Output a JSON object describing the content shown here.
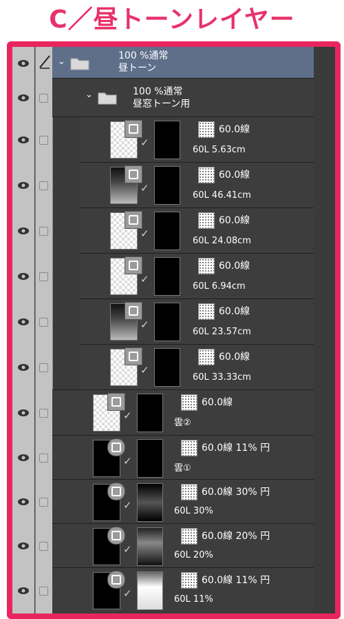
{
  "title": "C／昼トーンレイヤー",
  "folders": [
    {
      "line1": "100 %通常",
      "line2": "昼トーン"
    },
    {
      "line1": "100 %通常",
      "line2": "昼窓トーン用"
    }
  ],
  "layers": [
    {
      "tone": "60.0線",
      "name": "60L 5.63cm"
    },
    {
      "tone": "60.0線",
      "name": "60L 46.41cm"
    },
    {
      "tone": "60.0線",
      "name": "60L 24.08cm"
    },
    {
      "tone": "60.0線",
      "name": "60L 6.94cm"
    },
    {
      "tone": "60.0線",
      "name": "60L 23.57cm"
    },
    {
      "tone": "60.0線",
      "name": "60L 33.33cm"
    },
    {
      "tone": "60.0線",
      "name": "雲②"
    },
    {
      "tone": "60.0線 11% 円",
      "name": "雲①"
    },
    {
      "tone": "60.0線 30% 円",
      "name": "60L 30%"
    },
    {
      "tone": "60.0線 20% 円",
      "name": "60L 20%"
    },
    {
      "tone": "60.0線 11% 円",
      "name": "60L 11%"
    }
  ],
  "colors": {
    "accent": "#e8255e",
    "selected_row": "#5f6f8a",
    "panel_bg": "#3a3a3a",
    "row_bg": "#3d3d3d"
  }
}
